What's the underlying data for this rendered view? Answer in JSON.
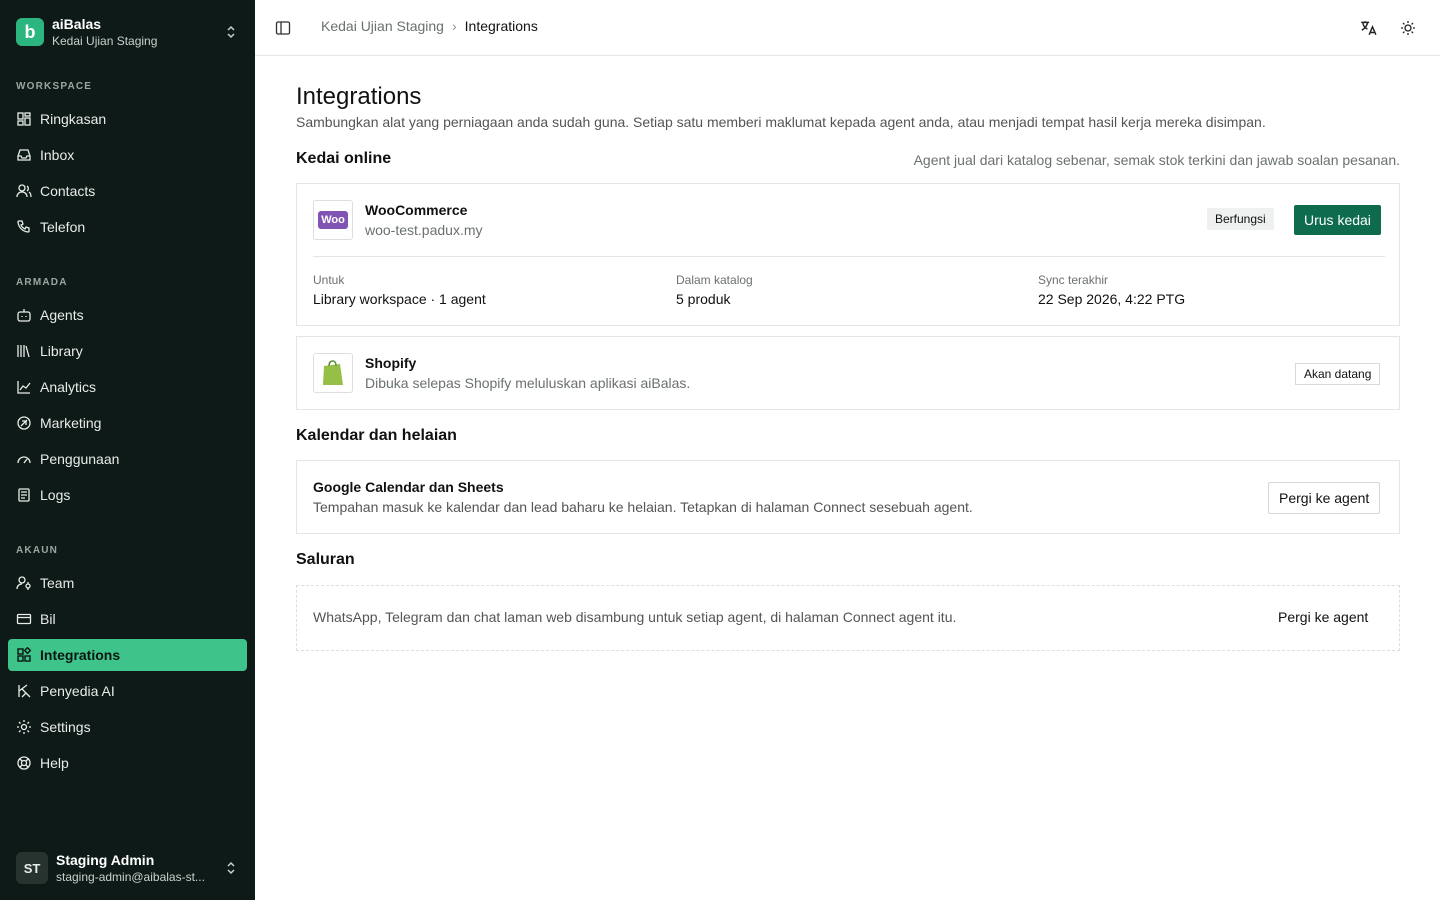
{
  "workspace": {
    "name": "aiBalas",
    "subtitle": "Kedai Ujian Staging",
    "logo_letter": "b",
    "accent": "#2bb57f"
  },
  "sidebar": {
    "sections": {
      "workspace": "WORKSPACE",
      "armada": "ARMADA",
      "akaun": "AKAUN"
    },
    "items": [
      {
        "label": "Ringkasan",
        "icon": "dashboard-icon"
      },
      {
        "label": "Inbox",
        "icon": "inbox-icon"
      },
      {
        "label": "Contacts",
        "icon": "contacts-icon"
      },
      {
        "label": "Telefon",
        "icon": "phone-icon"
      },
      {
        "label": "Agents",
        "icon": "bot-icon"
      },
      {
        "label": "Library",
        "icon": "library-icon"
      },
      {
        "label": "Analytics",
        "icon": "chart-line-icon"
      },
      {
        "label": "Marketing",
        "icon": "megaphone-icon"
      },
      {
        "label": "Penggunaan",
        "icon": "gauge-icon"
      },
      {
        "label": "Logs",
        "icon": "logs-icon"
      },
      {
        "label": "Team",
        "icon": "team-icon"
      },
      {
        "label": "Bil",
        "icon": "credit-card-icon"
      },
      {
        "label": "Integrations",
        "icon": "integrations-icon",
        "active": true
      },
      {
        "label": "Penyedia AI",
        "icon": "ai-provider-icon"
      },
      {
        "label": "Settings",
        "icon": "gear-icon"
      },
      {
        "label": "Help",
        "icon": "lifebuoy-icon"
      }
    ]
  },
  "user": {
    "initials": "ST",
    "name": "Staging Admin",
    "email": "staging-admin@aibalas-st..."
  },
  "header": {
    "crumb_parent": "Kedai Ujian Staging",
    "crumb_current": "Integrations",
    "sep": "›"
  },
  "page": {
    "title": "Integrations",
    "subtitle": "Sambungkan alat yang perniagaan anda sudah guna. Setiap satu memberi maklumat kepada agent anda, atau menjadi tempat hasil kerja mereka disimpan."
  },
  "online_store": {
    "heading": "Kedai online",
    "note": "Agent jual dari katalog sebenar, semak stok terkini dan jawab soalan pesanan.",
    "woo": {
      "name": "WooCommerce",
      "url": "woo-test.padux.my",
      "logo_text": "Woo",
      "status": "Berfungsi",
      "button": "Urus kedai",
      "meta": [
        {
          "label": "Untuk",
          "value": "Library workspace · 1 agent"
        },
        {
          "label": "Dalam katalog",
          "value": "5 produk"
        },
        {
          "label": "Sync terakhir",
          "value": "22 Sep 2026, 4:22 PTG"
        }
      ]
    },
    "shopify": {
      "name": "Shopify",
      "desc": "Dibuka selepas Shopify meluluskan aplikasi aiBalas.",
      "logo_letter": "S",
      "badge": "Akan datang"
    }
  },
  "calendar": {
    "heading": "Kalendar dan helaian",
    "title": "Google Calendar dan Sheets",
    "desc": "Tempahan masuk ke kalendar dan lead baharu ke helaian. Tetapkan di halaman Connect sesebuah agent.",
    "button": "Pergi ke agent"
  },
  "channels": {
    "heading": "Saluran",
    "desc": "WhatsApp, Telegram dan chat laman web disambung untuk setiap agent, di halaman Connect agent itu.",
    "button": "Pergi ke agent"
  },
  "colors": {
    "sidebar_bg": "#0e1a17",
    "active_bg": "#3ec48a",
    "primary_btn": "#0e6b4e",
    "woo_purple": "#7f54b3",
    "shopify_green": "#95bf47"
  }
}
